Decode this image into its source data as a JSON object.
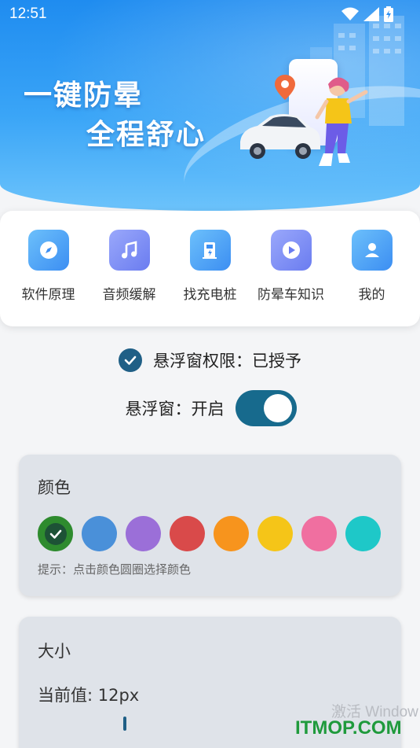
{
  "status_bar": {
    "time": "12:51",
    "icons": [
      "wifi-icon",
      "signal-icon",
      "battery-icon"
    ]
  },
  "banner": {
    "slogan_line1": "一键防晕",
    "slogan_line2": "全程舒心",
    "colors": {
      "top": "#1f8cf0",
      "bottom": "#6cc3fb"
    }
  },
  "menu": {
    "items": [
      {
        "label": "软件原理",
        "icon": "compass-icon",
        "color": "#4aa6f5"
      },
      {
        "label": "音频缓解",
        "icon": "music-note-icon",
        "color": "#7b8cf5"
      },
      {
        "label": "找充电桩",
        "icon": "charging-station-icon",
        "color": "#4aa6f5"
      },
      {
        "label": "防晕车知识",
        "icon": "play-icon",
        "color": "#7b8cf5"
      },
      {
        "label": "我的",
        "icon": "user-icon",
        "color": "#4aa6f5"
      }
    ]
  },
  "permission": {
    "text": "悬浮窗权限：已授予",
    "checked": true
  },
  "floating_window": {
    "label": "悬浮窗：开启",
    "enabled": true,
    "toggle_color": "#176a8d"
  },
  "color_section": {
    "title": "颜色",
    "swatches": [
      {
        "color": "#2e8b2e",
        "selected": true
      },
      {
        "color": "#4a90d9",
        "selected": false
      },
      {
        "color": "#9b6fd8",
        "selected": false
      },
      {
        "color": "#d94a4a",
        "selected": false
      },
      {
        "color": "#f7941d",
        "selected": false
      },
      {
        "color": "#f5c518",
        "selected": false
      },
      {
        "color": "#f06fa0",
        "selected": false
      },
      {
        "color": "#1ec8c8",
        "selected": false
      }
    ],
    "hint": "提示：点击颜色圆圈选择颜色"
  },
  "size_section": {
    "title": "大小",
    "current_value": "当前值: 12px"
  },
  "watermark": {
    "line1": "激活 Window",
    "line2": "ITMOP.COM"
  }
}
